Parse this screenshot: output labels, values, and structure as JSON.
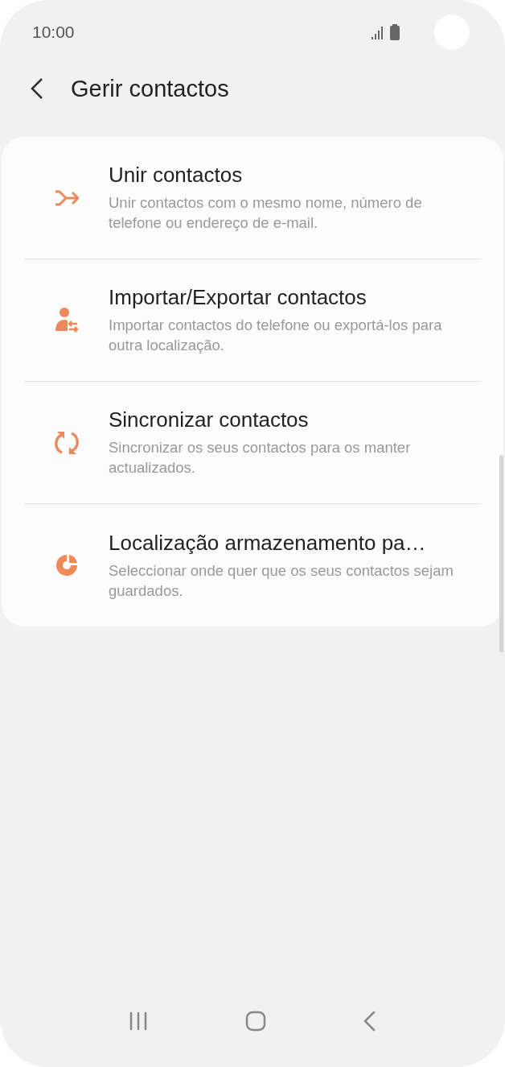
{
  "status_bar": {
    "time": "10:00"
  },
  "header": {
    "title": "Gerir contactos"
  },
  "items": [
    {
      "kind": "merge",
      "title": "Unir contactos",
      "subtitle": "Unir contactos com o mesmo nome, número de telefone ou endereço de e-mail."
    },
    {
      "kind": "transfer",
      "title": "Importar/Exportar contactos",
      "subtitle": "Importar contactos do telefone ou exportá-los para outra localização."
    },
    {
      "kind": "sync",
      "title": "Sincronizar contactos",
      "subtitle": "Sincronizar os seus contactos para os manter actualizados."
    },
    {
      "kind": "storage",
      "title": "Localização armazenamento pa…",
      "subtitle": "Seleccionar onde quer que os seus contactos sejam guardados."
    }
  ]
}
